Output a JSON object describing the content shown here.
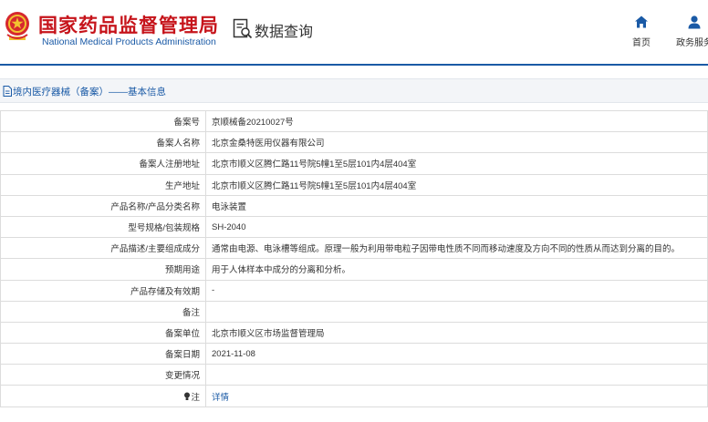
{
  "header": {
    "title": "国家药品监督管理局",
    "subtitle": "National Medical Products Administration",
    "query_title": "数据查询",
    "nav": [
      {
        "label": "首页",
        "icon": "home-icon"
      },
      {
        "label": "政务服务",
        "icon": "user-icon"
      }
    ]
  },
  "breadcrumb": {
    "text": "境内医疗器械（备案）——基本信息",
    "icon": "document-icon"
  },
  "record": {
    "rows": [
      {
        "label": "备案号",
        "value": "京顺械备20210027号"
      },
      {
        "label": "备案人名称",
        "value": "北京金桑特医用仪器有限公司"
      },
      {
        "label": "备案人注册地址",
        "value": "北京市顺义区腾仁路11号院5幢1至5层101内4层404室"
      },
      {
        "label": "生产地址",
        "value": "北京市顺义区腾仁路11号院5幢1至5层101内4层404室"
      },
      {
        "label": "产品名称/产品分类名称",
        "value": "电泳装置"
      },
      {
        "label": "型号规格/包装规格",
        "value": "SH-2040"
      },
      {
        "label": "产品描述/主要组成成分",
        "value": "通常由电源、电泳槽等组成。原理一般为利用带电粒子因带电性质不同而移动速度及方向不同的性质从而达到分离的目的。"
      },
      {
        "label": "预期用途",
        "value": "用于人体样本中成分的分离和分析。"
      },
      {
        "label": "产品存储及有效期",
        "value": "-"
      },
      {
        "label": "备注",
        "value": ""
      },
      {
        "label": "备案单位",
        "value": "北京市顺义区市场监督管理局"
      },
      {
        "label": "备案日期",
        "value": "2021-11-08"
      },
      {
        "label": "变更情况",
        "value": ""
      }
    ],
    "note_label": "注",
    "note_icon": "bulb-icon",
    "detail_link": "详情"
  },
  "colors": {
    "brand_red": "#c6141b",
    "brand_blue": "#1a5aa6"
  }
}
